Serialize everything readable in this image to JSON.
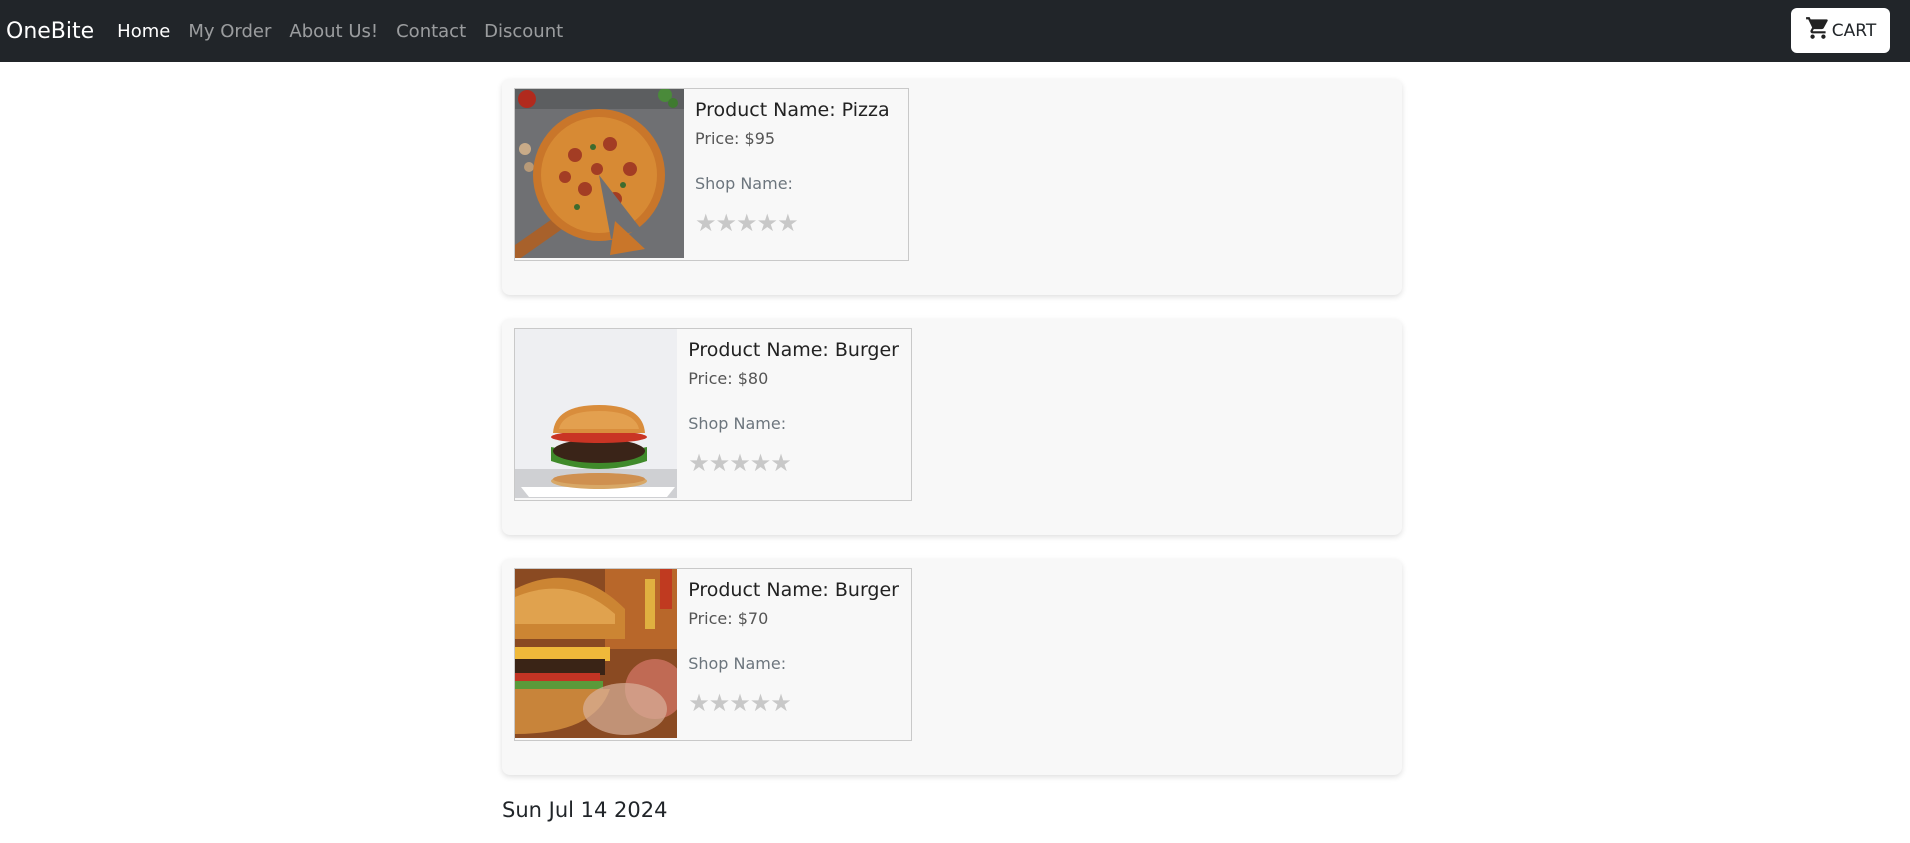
{
  "navbar": {
    "brand": "OneBite",
    "links": [
      "Home",
      "My Order",
      "About Us!",
      "Contact",
      "Discount"
    ],
    "cart_label": "CART"
  },
  "orders": [
    {
      "name": "Product Name: Pizza",
      "price": "Price: $95",
      "shop": "Shop Name:",
      "stars": "★★★★★",
      "image": "pizza"
    },
    {
      "name": "Product Name: Burger",
      "price": "Price: $80",
      "shop": "Shop Name:",
      "stars": "★★★★★",
      "image": "burger-on-plate"
    },
    {
      "name": "Product Name: Burger",
      "price": "Price: $70",
      "shop": "Shop Name:",
      "stars": "★★★★★",
      "image": "cheeseburger-closeup"
    }
  ],
  "order_date": "Sun Jul 14 2024",
  "colors": {
    "navbar_bg": "#212529",
    "card_bg": "#f8f8f8",
    "star_empty": "#c8c8c8"
  }
}
